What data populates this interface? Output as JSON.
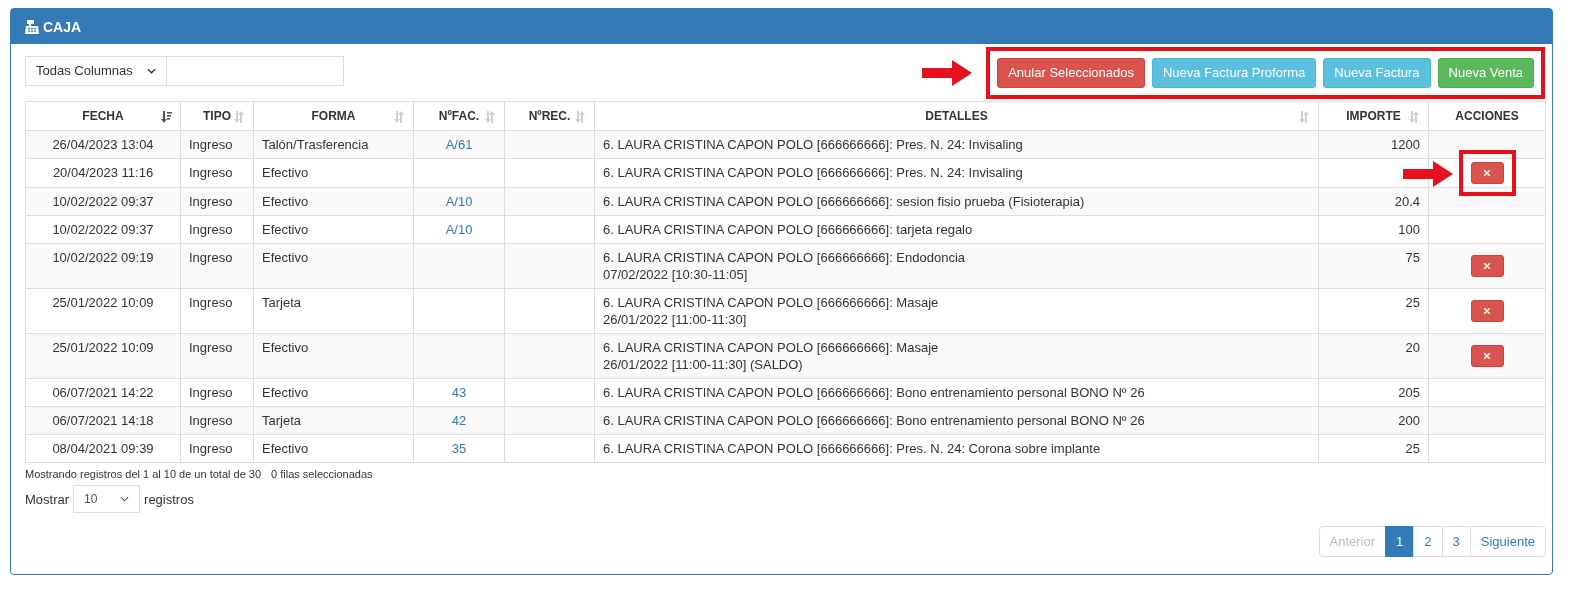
{
  "panel": {
    "title": "CAJA"
  },
  "filter": {
    "column_select": "Todas Columnas"
  },
  "toolbar": {
    "highlighted": true,
    "buttons": [
      {
        "label": "Anular Seleccionados",
        "kind": "danger"
      },
      {
        "label": "Nueva Factura Proforma",
        "kind": "info"
      },
      {
        "label": "Nueva Factura",
        "kind": "info"
      },
      {
        "label": "Nueva Venta",
        "kind": "success"
      }
    ]
  },
  "table": {
    "columns": [
      {
        "label": "FECHA",
        "sortable": true,
        "sorted": true
      },
      {
        "label": "TIPO",
        "sortable": true,
        "sorted": false
      },
      {
        "label": "FORMA",
        "sortable": true,
        "sorted": false
      },
      {
        "label": "NºFAC.",
        "sortable": true,
        "sorted": false
      },
      {
        "label": "NºREC.",
        "sortable": true,
        "sorted": false
      },
      {
        "label": "DETALLES",
        "sortable": true,
        "sorted": false
      },
      {
        "label": "IMPORTE",
        "sortable": true,
        "sorted": false
      },
      {
        "label": "ACCIONES",
        "sortable": false
      }
    ],
    "rows": [
      {
        "fecha": "26/04/2023 13:04",
        "tipo": "Ingreso",
        "forma": "Talón/Trasferencia",
        "nfac": "A/61",
        "detalles": [
          "6. LAURA CRISTINA CAPON POLO [666666666]: Pres. N. 24: Invisaling"
        ],
        "importe": "1200",
        "delete": false,
        "highlighted": false
      },
      {
        "fecha": "20/04/2023 11:16",
        "tipo": "Ingreso",
        "forma": "Efectivo",
        "detalles": [
          "6. LAURA CRISTINA CAPON POLO [666666666]: Pres. N. 24: Invisaling"
        ],
        "delete": true,
        "highlighted": true
      },
      {
        "fecha": "10/02/2022 09:37",
        "tipo": "Ingreso",
        "forma": "Efectivo",
        "nfac": "A/10",
        "detalles": [
          "6. LAURA CRISTINA CAPON POLO [666666666]: sesion fisio prueba (Fisioterapia)"
        ],
        "importe": "20.4",
        "delete": false,
        "highlighted": false
      },
      {
        "fecha": "10/02/2022 09:37",
        "tipo": "Ingreso",
        "forma": "Efectivo",
        "nfac": "A/10",
        "detalles": [
          "6. LAURA CRISTINA CAPON POLO [666666666]: tarjeta regalo"
        ],
        "importe": "100",
        "delete": false,
        "highlighted": false
      },
      {
        "fecha": "10/02/2022 09:19",
        "tipo": "Ingreso",
        "forma": "Efectivo",
        "detalles": [
          "6. LAURA CRISTINA CAPON POLO [666666666]: Endodoncia",
          "07/02/2022 [10:30-11:05]"
        ],
        "importe": "75",
        "delete": true,
        "highlighted": false
      },
      {
        "fecha": "25/01/2022 10:09",
        "tipo": "Ingreso",
        "forma": "Tarjeta",
        "detalles": [
          "6. LAURA CRISTINA CAPON POLO [666666666]: Masaje",
          "26/01/2022 [11:00-11:30]"
        ],
        "importe": "25",
        "delete": true,
        "highlighted": false
      },
      {
        "fecha": "25/01/2022 10:09",
        "tipo": "Ingreso",
        "forma": "Efectivo",
        "detalles": [
          "6. LAURA CRISTINA CAPON POLO [666666666]: Masaje",
          "26/01/2022 [11:00-11:30] (SALDO)"
        ],
        "importe": "20",
        "delete": true,
        "highlighted": false
      },
      {
        "fecha": "06/07/2021 14:22",
        "tipo": "Ingreso",
        "forma": "Efectivo",
        "nfac": "43",
        "detalles": [
          "6. LAURA CRISTINA CAPON POLO [666666666]: Bono entrenamiento personal BONO Nº 26"
        ],
        "importe": "205",
        "delete": false,
        "highlighted": false
      },
      {
        "fecha": "06/07/2021 14:18",
        "tipo": "Ingreso",
        "forma": "Tarjeta",
        "nfac": "42",
        "detalles": [
          "6. LAURA CRISTINA CAPON POLO [666666666]: Bono entrenamiento personal BONO Nº 26"
        ],
        "importe": "200",
        "delete": false,
        "highlighted": false
      },
      {
        "fecha": "08/04/2021 09:39",
        "tipo": "Ingreso",
        "forma": "Efectivo",
        "nfac": "35",
        "detalles": [
          "6. LAURA CRISTINA CAPON POLO [666666666]: Pres. N. 24: Corona sobre implante"
        ],
        "importe": "25",
        "delete": false,
        "highlighted": false
      }
    ]
  },
  "info": {
    "records": "Mostrando registros del 1 al 10 de un total de 30",
    "selected": "0 filas seleccionadas"
  },
  "length": {
    "before": "Mostrar",
    "value": "10",
    "after": "registros"
  },
  "pagination": [
    {
      "label": "Anterior",
      "selected": false,
      "disabled": true
    },
    {
      "label": "1",
      "selected": true,
      "disabled": false
    },
    {
      "label": "2",
      "selected": false,
      "disabled": false
    },
    {
      "label": "3",
      "selected": false,
      "disabled": false
    },
    {
      "label": "Siguiente",
      "selected": false,
      "disabled": false
    }
  ]
}
